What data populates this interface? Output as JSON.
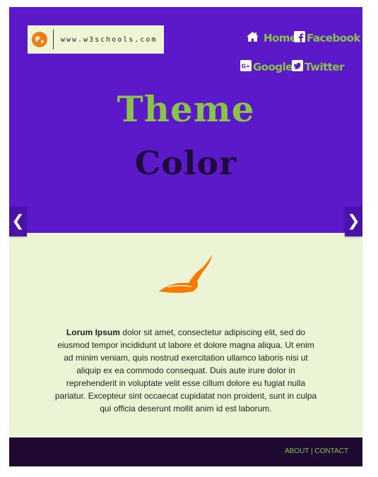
{
  "logo": {
    "text": "www.w3schools.com"
  },
  "nav": {
    "home": "Home",
    "facebook": "Facebook",
    "google": "Google+",
    "twitter": "Twitter"
  },
  "hero": {
    "title_line1": "Theme",
    "title_line2": "Color",
    "prev_arrow": "❮",
    "next_arrow": "❯"
  },
  "content": {
    "lead": "Lorum Ipsum",
    "body": "dolor sit amet, consectetur adipiscing elit, sed do eiusmod tempor incididunt ut labore et dolore magna aliqua. Ut enim ad minim veniam, quis nostrud exercitation ullamco laboris nisi ut aliquip ex ea commodo consequat. Duis aute irure dolor in reprehenderit in voluptate velit esse cillum dolore eu fugiat nulla pariatur. Excepteur sint occaecat cupidatat non proident, sunt in culpa qui officia deserunt mollit anim id est laborum."
  },
  "footer": {
    "about": "ABOUT",
    "separator": "|",
    "contact": "CONTACT"
  },
  "colors": {
    "hero_bg": "#5c19c9",
    "accent_green": "#8bc34a",
    "content_bg": "#ebf5d6",
    "footer_bg": "#1e0a30",
    "dark_title": "#1e0a3c",
    "feather_orange": "#f57c00"
  },
  "icons": {
    "logo": "globe-icon",
    "home": "home-icon",
    "facebook": "facebook-icon",
    "google": "google-plus-icon",
    "twitter": "twitter-icon",
    "content": "feather-hat-icon"
  }
}
